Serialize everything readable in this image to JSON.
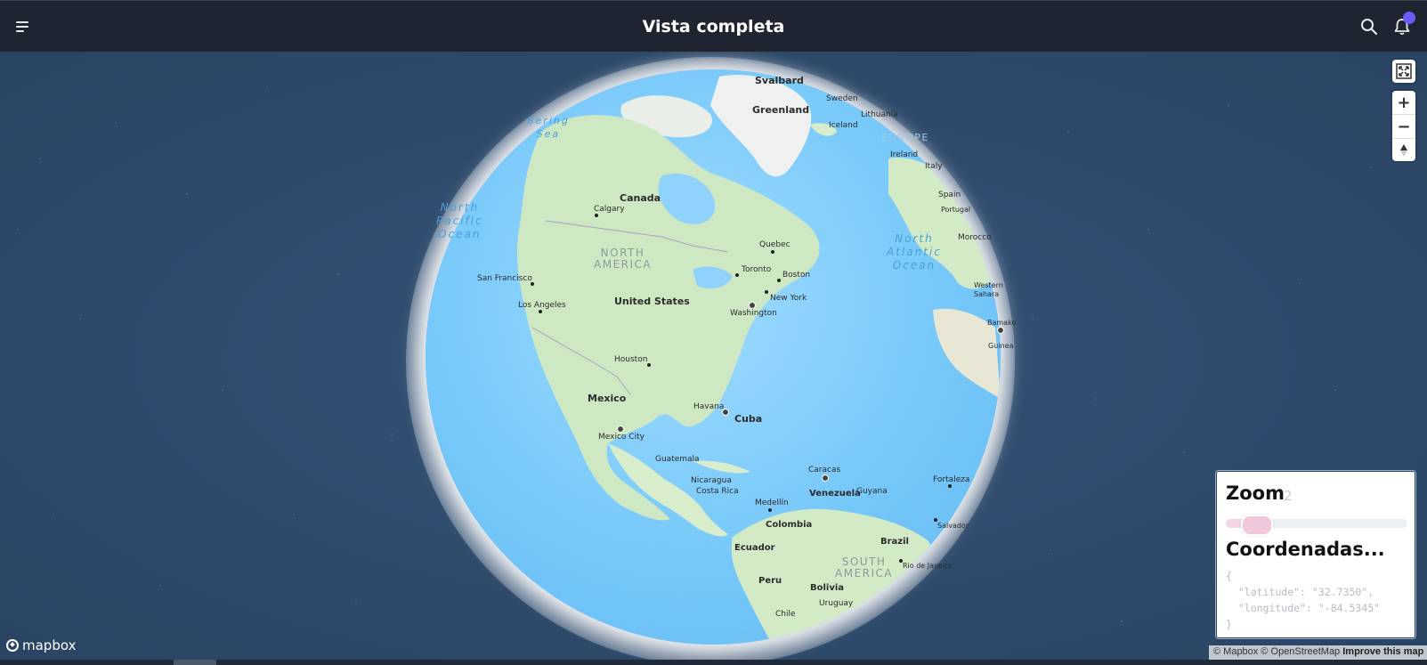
{
  "header": {
    "title": "Vista completa",
    "icons": [
      "menu-icon",
      "search-icon",
      "bell-icon"
    ]
  },
  "map": {
    "style": "globe",
    "labels": {
      "oceans": [
        {
          "name": "Bering Sea",
          "lines": [
            "Bering",
            "Sea"
          ]
        },
        {
          "name": "North Pacific Ocean",
          "lines": [
            "North",
            "Pacific",
            "Ocean"
          ]
        },
        {
          "name": "North Atlantic Ocean",
          "lines": [
            "North",
            "Atlantic",
            "Ocean"
          ]
        }
      ],
      "continents": [
        {
          "name": "NORTH AMERICA",
          "lines": [
            "NORTH",
            "AMERICA"
          ]
        },
        {
          "name": "SOUTH AMERICA",
          "lines": [
            "SOUTH",
            "AMERICA"
          ]
        },
        {
          "name": "EUROPE",
          "lines": [
            "EUROPE"
          ]
        }
      ],
      "countries": [
        "Svalbard",
        "Greenland",
        "Sweden",
        "Lithuania",
        "Iceland",
        "Ireland",
        "Italy",
        "Spain",
        "Portugal",
        "Morocco",
        "Western Sahara",
        "Guinea",
        "Canada",
        "United States",
        "Mexico",
        "Cuba",
        "Guatemala",
        "Nicaragua",
        "Costa Rica",
        "Venezuela",
        "Guyana",
        "Colombia",
        "Ecuador",
        "Brazil",
        "Peru",
        "Bolivia",
        "Uruguay",
        "Chile"
      ],
      "cities": [
        "Calgary",
        "Quebec",
        "Toronto",
        "Boston",
        "New York",
        "Washington",
        "San Francisco",
        "Los Angeles",
        "Houston",
        "Havana",
        "Mexico City",
        "Caracas",
        "Medellín",
        "Fortaleza",
        "Salvador",
        "Rio de Janeiro",
        "Bamako"
      ]
    }
  },
  "controls": {
    "fullscreen": "fullscreen-icon",
    "zoom_in": "+",
    "zoom_out": "−",
    "compass": "compass-icon"
  },
  "panel": {
    "zoom_label": "Zoom",
    "zoom_value": "2",
    "zoom_slider_fraction": 0.1,
    "coord_label": "Coordenadas...",
    "coordinates_json": "{\n  \"latitude\": \"32.7350\",\n  \"longitude\": \"-84.5345\"\n}"
  },
  "attribution": {
    "mapbox": "© Mapbox",
    "osm": "© OpenStreetMap",
    "improve": "Improve this map"
  },
  "logo": "mapbox",
  "colors": {
    "header_bg": "#1e2530",
    "space_bg": "#2c4766",
    "ocean": "#77c8fa",
    "land": "#cfe8c4",
    "accent_dot": "#6a5cf6"
  }
}
